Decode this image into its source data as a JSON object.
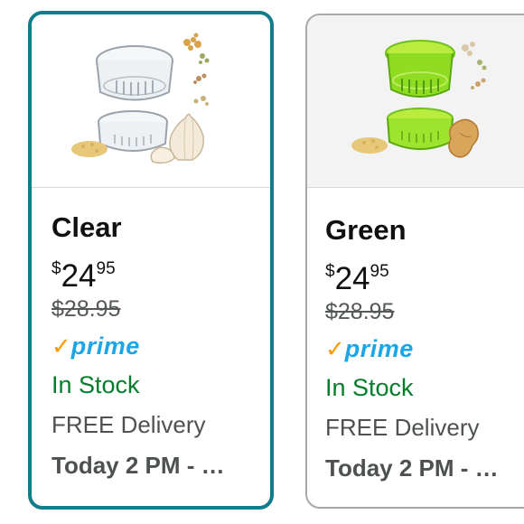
{
  "variants": [
    {
      "color_name": "Clear",
      "price_symbol": "$",
      "price_whole": "24",
      "price_fraction": "95",
      "list_price": "$28.95",
      "prime_check": "✓",
      "prime_label": "prime",
      "availability": "In Stock",
      "delivery_label": "FREE Delivery",
      "delivery_date": "Today 2 PM - …",
      "selected": true,
      "accent_color": "#127c8a"
    },
    {
      "color_name": "Green",
      "price_symbol": "$",
      "price_whole": "24",
      "price_fraction": "95",
      "list_price": "$28.95",
      "prime_check": "✓",
      "prime_label": "prime",
      "availability": "In Stock",
      "delivery_label": "FREE Delivery",
      "delivery_date": "Today 2 PM - …",
      "selected": false,
      "accent_color": "#7ed321"
    }
  ],
  "colors": {
    "selected_border": "#127c8a",
    "prime_blue": "#1ca6e6",
    "prime_check_orange": "#ff9900",
    "in_stock_green": "#067d2b"
  },
  "icons": {
    "product_image": "garlic-press-product-image",
    "prime_check": "prime-checkmark-icon"
  }
}
